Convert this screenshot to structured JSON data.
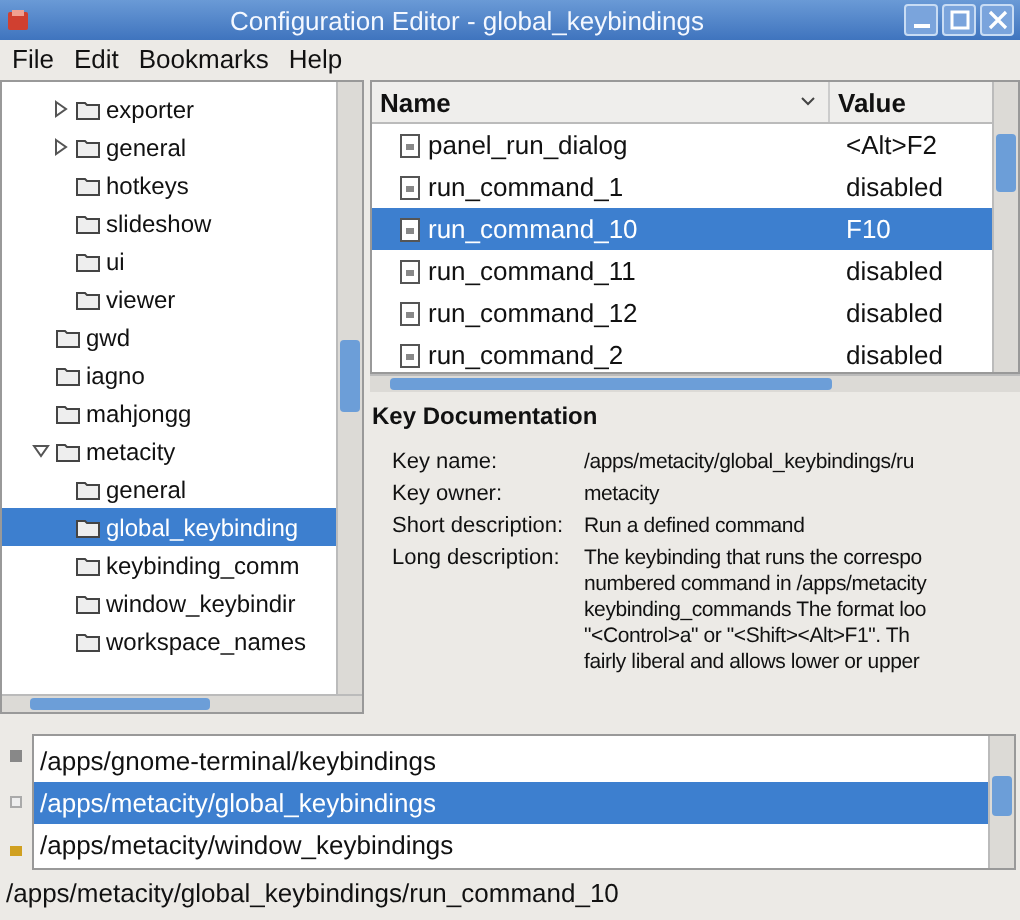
{
  "window": {
    "title": "Configuration Editor - global_keybindings"
  },
  "menu": [
    "File",
    "Edit",
    "Bookmarks",
    "Help"
  ],
  "tree": [
    {
      "label": "exporter",
      "expanded": false
    },
    {
      "label": "general",
      "expanded": false
    },
    {
      "label": "hotkeys",
      "selected": false
    },
    {
      "label": "slideshow",
      "selected": false
    },
    {
      "label": "ui",
      "selected": false
    },
    {
      "label": "viewer",
      "selected": false
    }
  ],
  "tree_top": [
    {
      "label": "gwd",
      "selected": false
    },
    {
      "label": "iagno",
      "selected": false
    },
    {
      "label": "mahjongg",
      "selected": false
    },
    {
      "label": "metacity",
      "expanded": true,
      "selected": false,
      "children": [
        {
          "label": "general",
          "selected": false
        },
        {
          "label": "global_keybinding",
          "selected": true
        },
        {
          "label": "keybinding_comm",
          "selected": false
        },
        {
          "label": "window_keybindir",
          "selected": false
        },
        {
          "label": "workspace_names",
          "selected": false
        }
      ]
    }
  ],
  "table": {
    "columns": [
      "Name",
      "Value"
    ],
    "rows": [
      {
        "name": "panel_run_dialog",
        "value": "<Alt>F2",
        "selected": false
      },
      {
        "name": "run_command_1",
        "value": "disabled",
        "selected": false
      },
      {
        "name": "run_command_10",
        "value": "F10",
        "selected": true
      },
      {
        "name": "run_command_11",
        "value": "disabled",
        "selected": false
      },
      {
        "name": "run_command_12",
        "value": "disabled",
        "selected": false
      },
      {
        "name": "run_command_2",
        "value": "disabled",
        "selected": false
      }
    ]
  },
  "documentation": {
    "title": "Key Documentation",
    "fields": [
      {
        "label": "Key name:",
        "lines": [
          "/apps/metacity/global_keybindings/ru"
        ]
      },
      {
        "label": "Key owner:",
        "lines": [
          "metacity"
        ]
      },
      {
        "label": "Short description:",
        "lines": [
          "Run a defined command"
        ]
      },
      {
        "label": "Long description:",
        "lines": [
          "The keybinding that runs the correspo",
          "numbered command in /apps/metacity",
          "keybinding_commands The format loo",
          "\"<Control>a\" or \"<Shift><Alt>F1\". Th",
          "fairly liberal and allows lower or upper"
        ]
      }
    ]
  },
  "recent": [
    {
      "path": "/apps/gnome-terminal/keybindings",
      "selected": false
    },
    {
      "path": "/apps/metacity/global_keybindings",
      "selected": true
    },
    {
      "path": "/apps/metacity/window_keybindings",
      "selected": false
    }
  ],
  "status_bar": "/apps/metacity/global_keybindings/run_command_10"
}
